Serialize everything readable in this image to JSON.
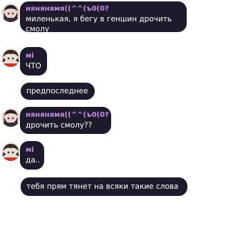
{
  "colors": {
    "bubble": "#1e1a2b",
    "text": "#ffffff",
    "name_a": "#c48fe6",
    "name_b": "#c48fe6"
  },
  "messages": [
    {
      "sender": "нянянямя((^^(ъ0(0?",
      "line1": "миленькая, я бегу в геншин дрочить",
      "line2": "смолу"
    },
    {
      "sender": "мі",
      "text": "ЧТО"
    },
    {
      "text": "предпоследнее"
    },
    {
      "sender": "нянянямя((^^(ъ0(0?",
      "text": "дрочить смолу??"
    },
    {
      "sender": "мі",
      "text": "да.."
    },
    {
      "text": "тебя прям тянет на всяки такие слова"
    }
  ]
}
